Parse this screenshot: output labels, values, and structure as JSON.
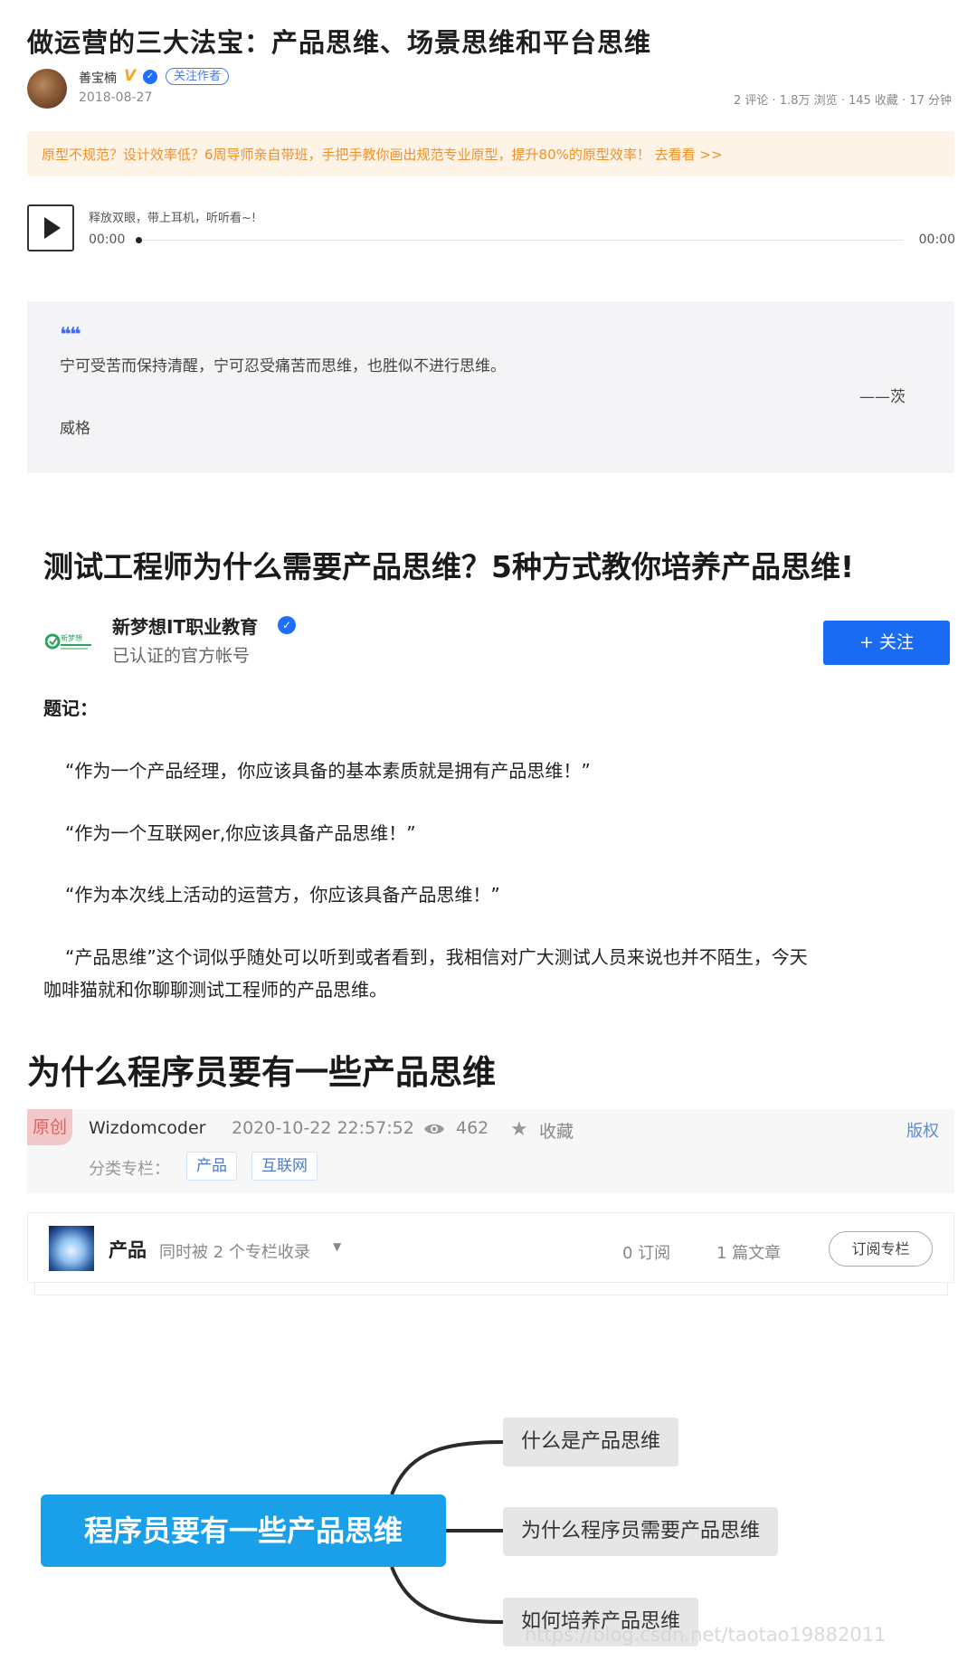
{
  "article1": {
    "title": "做运营的三大法宝：产品思维、场景思维和平台思维",
    "author": "善宝楠",
    "author_badge": "V",
    "follow_label": "关注作者",
    "date": "2018-08-27",
    "stats": "2 评论 · 1.8万 浏览 · 145 收藏 · 17 分钟",
    "promo": "原型不规范？设计效率低？6周导师亲自带班，手把手教你画出规范专业原型，提升80%的原型效率！ 去看看 >>",
    "audio": {
      "hint": "释放双眼，带上耳机，听听看~!",
      "current": "00:00",
      "duration": "00:00",
      "progress": 0
    },
    "quote": {
      "text": "宁可受苦而保持清醒，宁可忍受痛苦而思维，也胜似不进行思维。",
      "dash": "——茨",
      "name": "威格"
    }
  },
  "article2": {
    "title": "测试工程师为什么需要产品思维？5种方式教你培养产品思维!",
    "org_name": "新梦想IT职业教育",
    "org_sub": "已认证的官方帐号",
    "logo_text": "新梦想",
    "follow_label": "+ 关注",
    "section_title": "题记：",
    "quotes": [
      "“作为一个产品经理，你应该具备的基本素质就是拥有产品思维！”",
      "“作为一个互联网er,你应该具备产品思维！”",
      "“作为本次线上活动的运营方，你应该具备产品思维！”"
    ],
    "para_line1": "“产品思维”这个词似乎随处可以听到或者看到，我相信对广大测试人员来说也并不陌生，今天",
    "para_line2": "咖啡猫就和你聊聊测试工程师的产品思维。"
  },
  "article3": {
    "title": "为什么程序员要有一些产品思维",
    "badge": "原创",
    "author": "Wizdomcoder",
    "datetime": "2020-10-22 22:57:52",
    "views": "462",
    "favorite_label": "收藏",
    "copyright": "版权",
    "category_label": "分类专栏：",
    "tags": [
      "产品",
      "互联网"
    ],
    "column": {
      "name": "产品",
      "sub": "同时被 2 个专栏收录",
      "subs": "0 订阅",
      "posts": "1 篇文章",
      "subscribe_label": "订阅专栏"
    },
    "mindmap": {
      "root": "程序员要有一些产品思维",
      "children": [
        "什么是产品思维",
        "为什么程序员需要产品思维",
        "如何培养产品思维"
      ]
    },
    "watermark": "https://blog.csdn.net/taotao19882011"
  },
  "colors": {
    "accent_blue": "#1a6bf4",
    "promo_orange": "#f0902b",
    "mindmap_root": "#1aa0e8",
    "original_badge": "#e35d5d"
  }
}
